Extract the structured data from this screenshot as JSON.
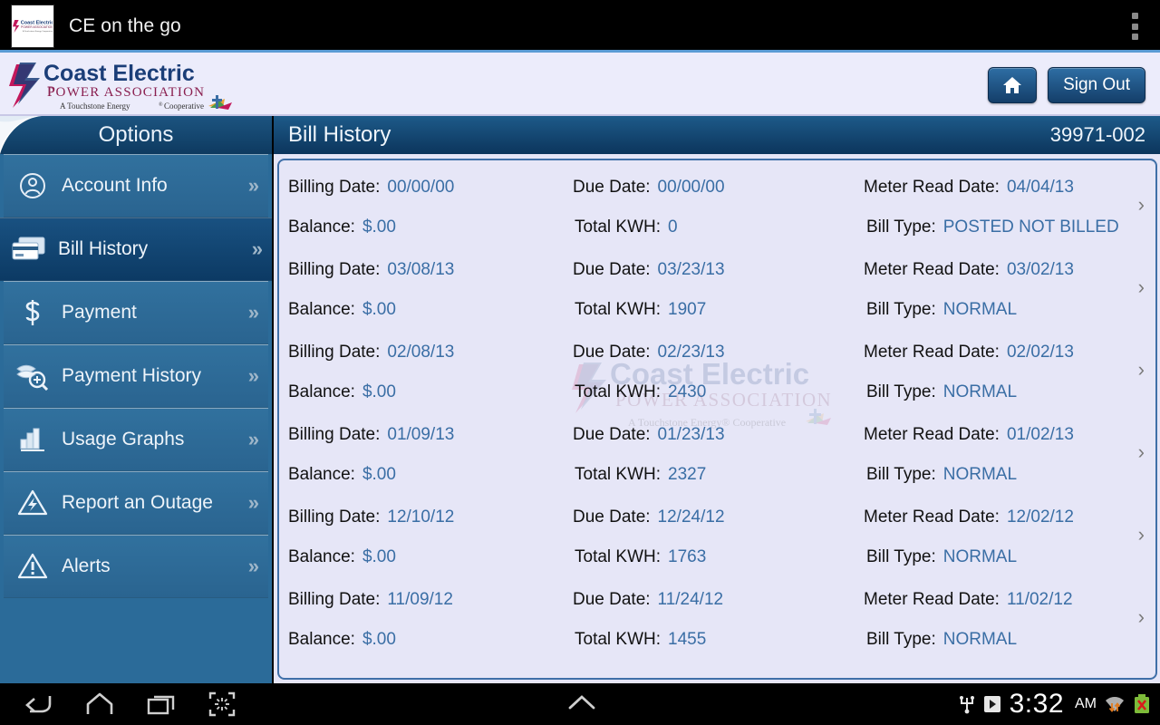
{
  "titlebar": {
    "app_name": "CE on the go",
    "app_icon": "coast-electric-app-icon",
    "overflow_icon": "overflow-menu-icon"
  },
  "brand": {
    "logo_line1": "Coast Electric",
    "logo_line2": "POWER   ASSOCIATION",
    "logo_tagline": "A Touchstone Energy® Cooperative",
    "home_button_icon": "home-icon",
    "sign_out_label": "Sign Out"
  },
  "sidebar": {
    "header": "Options",
    "items": [
      {
        "label": "Account Info",
        "icon": "person-circle-icon",
        "selected": false
      },
      {
        "label": "Bill History",
        "icon": "credit-card-icon",
        "selected": true
      },
      {
        "label": "Payment",
        "icon": "dollar-icon",
        "selected": false
      },
      {
        "label": "Payment History",
        "icon": "money-search-icon",
        "selected": false
      },
      {
        "label": "Usage Graphs",
        "icon": "bar-chart-icon",
        "selected": false
      },
      {
        "label": "Report an Outage",
        "icon": "warning-bolt-icon",
        "selected": false
      },
      {
        "label": "Alerts",
        "icon": "warning-icon",
        "selected": false
      }
    ],
    "chevron": "»"
  },
  "main": {
    "title": "Bill History",
    "account_number": "39971-002",
    "row_chevron": "›",
    "labels": {
      "billing_date": "Billing Date:",
      "due_date": "Due Date:",
      "meter_read_date": "Meter Read Date:",
      "balance": "Balance:",
      "total_kwh": "Total KWH:",
      "bill_type": "Bill Type:"
    },
    "bills": [
      {
        "billing_date": "00/00/00",
        "due_date": "00/00/00",
        "meter_read_date": "04/04/13",
        "balance": "$.00",
        "total_kwh": "0",
        "bill_type": "POSTED NOT BILLED"
      },
      {
        "billing_date": "03/08/13",
        "due_date": "03/23/13",
        "meter_read_date": "03/02/13",
        "balance": "$.00",
        "total_kwh": "1907",
        "bill_type": "NORMAL"
      },
      {
        "billing_date": "02/08/13",
        "due_date": "02/23/13",
        "meter_read_date": "02/02/13",
        "balance": "$.00",
        "total_kwh": "2430",
        "bill_type": "NORMAL"
      },
      {
        "billing_date": "01/09/13",
        "due_date": "01/23/13",
        "meter_read_date": "01/02/13",
        "balance": "$.00",
        "total_kwh": "2327",
        "bill_type": "NORMAL"
      },
      {
        "billing_date": "12/10/12",
        "due_date": "12/24/12",
        "meter_read_date": "12/02/12",
        "balance": "$.00",
        "total_kwh": "1763",
        "bill_type": "NORMAL"
      },
      {
        "billing_date": "11/09/12",
        "due_date": "11/24/12",
        "meter_read_date": "11/02/12",
        "balance": "$.00",
        "total_kwh": "1455",
        "bill_type": "NORMAL"
      }
    ],
    "watermark": "coast-electric-watermark"
  },
  "navbar": {
    "back_icon": "back-icon",
    "home_icon": "home-icon",
    "recents_icon": "recent-apps-icon",
    "screenshot_icon": "screenshot-icon",
    "expand_icon": "chevron-up-icon",
    "usb_icon": "usb-icon",
    "play_store_icon": "play-store-icon",
    "time": "3:32",
    "meridiem": "AM",
    "wifi_icon": "wifi-icon",
    "battery_icon": "battery-error-icon"
  },
  "colors": {
    "brand_blue": "#1d5a89",
    "sidebar_blue": "#2b6b99",
    "selected_blue": "#0c3a64",
    "value_blue": "#3a6ea5",
    "content_bg": "#e6e6f7",
    "header_bg": "#ececfb"
  }
}
